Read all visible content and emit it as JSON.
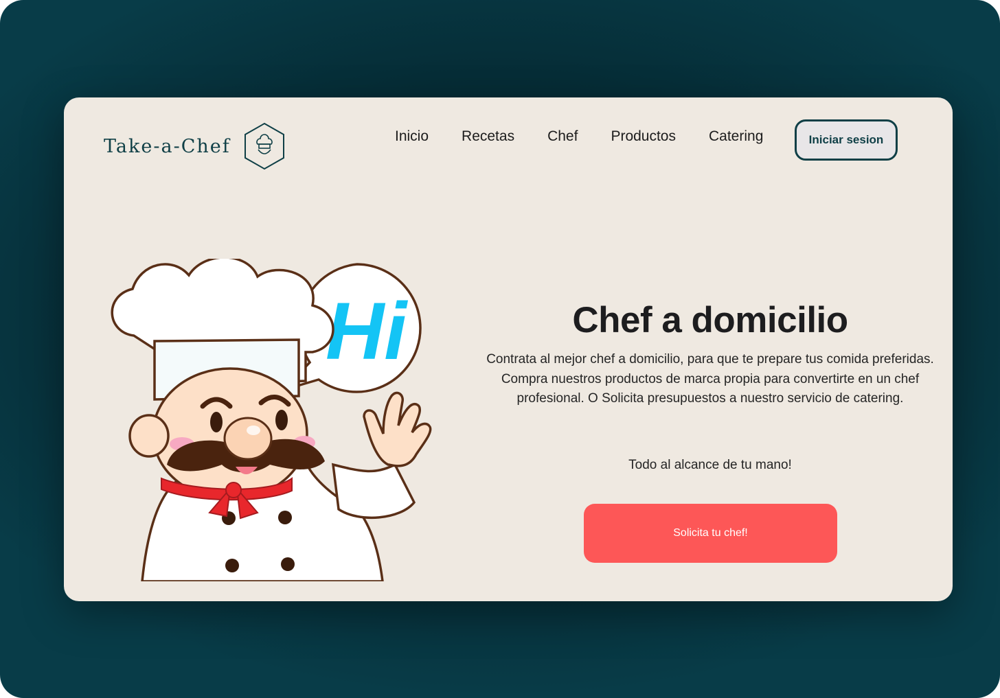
{
  "brand": {
    "name": "Take-a-Chef",
    "logo_icon": "chef-hat-hexagon-icon"
  },
  "nav": {
    "items": [
      "Inicio",
      "Recetas",
      "Chef",
      "Productos",
      "Catering"
    ]
  },
  "header": {
    "login_label": "Iniciar sesion"
  },
  "hero": {
    "title": "Chef a domicilio",
    "description": "Contrata al mejor chef a domicilio, para que te prepare tus comida preferidas. Compra nuestros productos de marca propia para convertirte en un chef profesional. O Solicita presupuestos a nuestro servicio de catering.",
    "tagline": "Todo al alcance de tu mano!",
    "cta_label": "Solicita tu chef!",
    "illustration": {
      "speech_bubble_text": "Hi"
    }
  },
  "colors": {
    "background_dark": "#062e38",
    "card_bg": "#efe9e1",
    "brand_teal": "#0f3f46",
    "cta_red": "#fd5757",
    "bubble_blue": "#14c4f5"
  }
}
